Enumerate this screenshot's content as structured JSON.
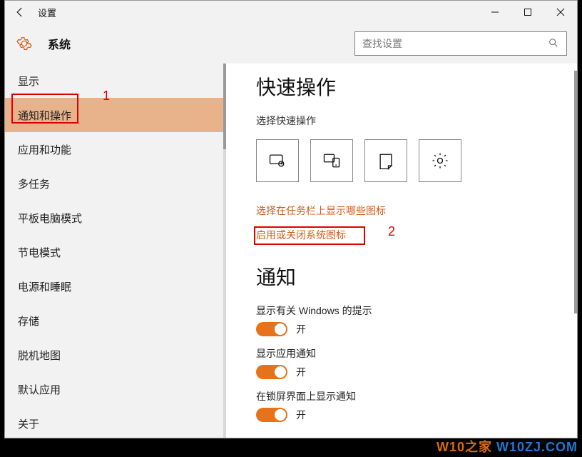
{
  "titlebar": {
    "title": "设置"
  },
  "subheader": {
    "system": "系统",
    "search_placeholder": "查找设置"
  },
  "sidebar": {
    "items": [
      {
        "label": "显示"
      },
      {
        "label": "通知和操作",
        "selected": true
      },
      {
        "label": "应用和功能"
      },
      {
        "label": "多任务"
      },
      {
        "label": "平板电脑模式"
      },
      {
        "label": "节电模式"
      },
      {
        "label": "电源和睡眠"
      },
      {
        "label": "存储"
      },
      {
        "label": "脱机地图"
      },
      {
        "label": "默认应用"
      },
      {
        "label": "关于"
      }
    ]
  },
  "content": {
    "quick_actions_title": "快速操作",
    "choose_quick_actions": "选择快速操作",
    "link_taskbar_icons": "选择在任务栏上显示哪些图标",
    "link_system_icons": "启用或关闭系统图标",
    "notifications_title": "通知",
    "settings": [
      {
        "label": "显示有关 Windows 的提示",
        "state": "开"
      },
      {
        "label": "显示应用通知",
        "state": "开"
      },
      {
        "label": "在锁屏界面上显示通知",
        "state": "开"
      }
    ]
  },
  "annotations": {
    "label1": "1",
    "label2": "2"
  },
  "watermark": {
    "t1": "W10之家",
    "t2": "W10ZJ.COM"
  }
}
